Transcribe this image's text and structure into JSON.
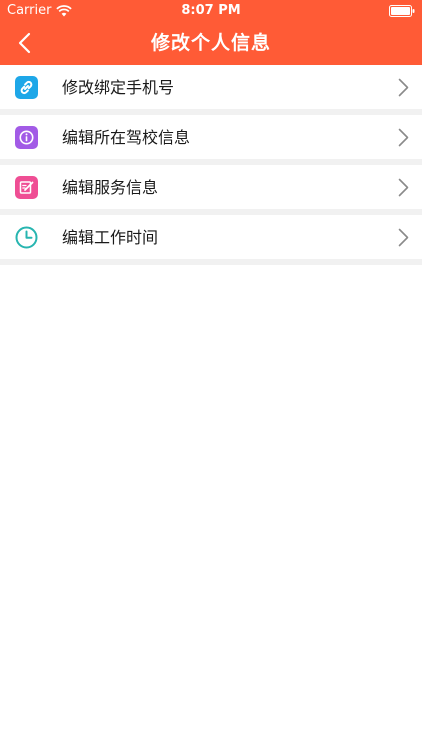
{
  "status_bar": {
    "carrier": "Carrier",
    "time": "8:07 PM",
    "wifi_icon": "wifi-icon",
    "battery_icon": "battery-icon"
  },
  "nav": {
    "title": "修改个人信息",
    "back_icon": "chevron-left-icon",
    "bar_color": "#FF5B36"
  },
  "menu": {
    "items": [
      {
        "label": "修改绑定手机号",
        "icon": "link-icon",
        "icon_color": "#1EA7E8"
      },
      {
        "label": "编辑所在驾校信息",
        "icon": "info-icon",
        "icon_color": "#A25BE6"
      },
      {
        "label": "编辑服务信息",
        "icon": "edit-icon",
        "icon_color": "#EF4E94"
      },
      {
        "label": "编辑工作时间",
        "icon": "clock-icon",
        "icon_color": "#27B5B0"
      }
    ]
  }
}
